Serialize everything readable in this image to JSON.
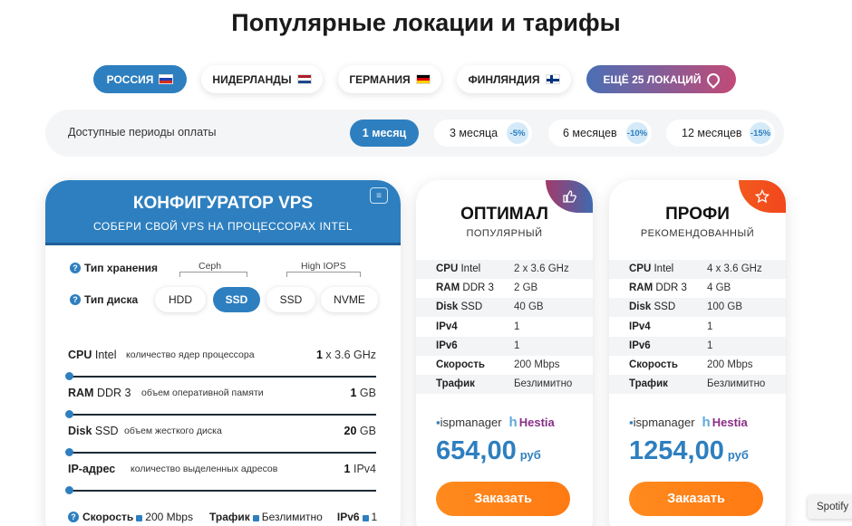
{
  "page_title": "Популярные локации и тарифы",
  "locations": [
    {
      "label": "РОССИЯ",
      "flag": "flag-ru",
      "active": true
    },
    {
      "label": "НИДЕРЛАНДЫ",
      "flag": "flag-nl",
      "active": false
    },
    {
      "label": "ГЕРМАНИЯ",
      "flag": "flag-de",
      "active": false
    },
    {
      "label": "ФИНЛЯНДИЯ",
      "flag": "flag-fi",
      "active": false
    },
    {
      "label": "ЕЩЁ 25 ЛОКАЦИЙ",
      "icon": "location-pin-icon"
    }
  ],
  "periods": {
    "label": "Доступные периоды оплаты",
    "options": [
      {
        "label": "1 месяц",
        "active": true
      },
      {
        "label": "3 месяца",
        "discount": "-5%"
      },
      {
        "label": "6 месяцев",
        "discount": "-10%"
      },
      {
        "label": "12 месяцев",
        "discount": "-15%"
      }
    ]
  },
  "configurator": {
    "title": "КОНФИГУРАТОР VPS",
    "subtitle": "СОБЕРИ СВОЙ VPS НА ПРОЦЕССОРАХ INTEL",
    "storage_label": "Тип хранения",
    "disk_label": "Тип диска",
    "group_ceph": "Ceph",
    "group_iops": "High IOPS",
    "disk_options": [
      "HDD",
      "SSD",
      "SSD",
      "NVME"
    ],
    "rows": [
      {
        "name_bold": "CPU",
        "name": " Intel",
        "desc": "количество ядер процессора",
        "val_bold": "1",
        "val": " x 3.6 GHz",
        "level": 0
      },
      {
        "name_bold": "RAM",
        "name": " DDR 3",
        "desc": "объем оперативной памяти",
        "val_bold": "1",
        "val": " GB",
        "level": 0
      },
      {
        "name_bold": "Disk",
        "name": " SSD",
        "desc": "объем жесткого диска",
        "val_bold": "20",
        "val": " GB",
        "level": 0
      },
      {
        "name_bold": "IP-адрес",
        "name": "",
        "desc": "количество выделенных адресов",
        "val_bold": "1",
        "val": " IPv4",
        "level": 0
      }
    ],
    "bottom": {
      "speed_label": "Скорость",
      "speed": "200 Mbps",
      "traffic_label": "Трафик",
      "traffic": "Безлимитно",
      "ipv6_label": "IPv6",
      "ipv6": "1"
    }
  },
  "plans": [
    {
      "name": "ОПТИМАЛ",
      "tag": "ПОПУЛЯРНЫЙ",
      "badge_icon": "thumbs-up-icon",
      "specs": [
        {
          "kb": "CPU",
          "k": " Intel",
          "v": "2 x 3.6 GHz"
        },
        {
          "kb": "RAM",
          "k": " DDR 3",
          "v": "2 GB"
        },
        {
          "kb": "Disk",
          "k": " SSD",
          "v": "40 GB"
        },
        {
          "kb": "IPv4",
          "k": "",
          "v": "1"
        },
        {
          "kb": "IPv6",
          "k": "",
          "v": "1"
        },
        {
          "kb": "Скорость",
          "k": "",
          "v": "200 Mbps"
        },
        {
          "kb": "Трафик",
          "k": "",
          "v": "Безлимитно"
        }
      ],
      "isp": "ispmanager",
      "hestia": "Hestia",
      "price": "654,00",
      "currency": "руб",
      "order": "Заказать"
    },
    {
      "name": "ПРОФИ",
      "tag": "РЕКОМЕНДОВАННЫЙ",
      "badge_icon": "star-icon",
      "specs": [
        {
          "kb": "CPU",
          "k": " Intel",
          "v": "4 x 3.6 GHz"
        },
        {
          "kb": "RAM",
          "k": " DDR 3",
          "v": "4 GB"
        },
        {
          "kb": "Disk",
          "k": " SSD",
          "v": "100 GB"
        },
        {
          "kb": "IPv4",
          "k": "",
          "v": "1"
        },
        {
          "kb": "IPv6",
          "k": "",
          "v": "1"
        },
        {
          "kb": "Скорость",
          "k": "",
          "v": "200 Mbps"
        },
        {
          "kb": "Трафик",
          "k": "",
          "v": "Безлимитно"
        }
      ],
      "isp": "ispmanager",
      "hestia": "Hestia",
      "price": "1254,00",
      "currency": "руб",
      "order": "Заказать"
    }
  ],
  "spotify_label": "Spotify"
}
